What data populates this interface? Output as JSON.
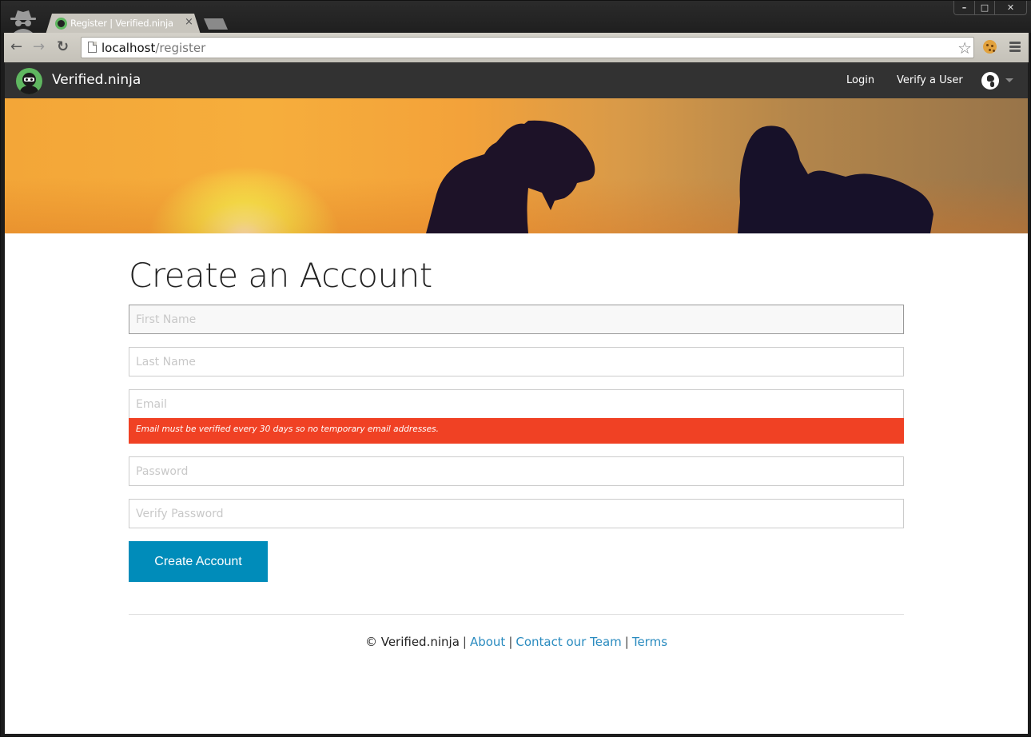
{
  "browser": {
    "tab_title": "Register | Verified.ninja",
    "tab_close": "×",
    "url_host": "localhost",
    "url_path": "/register",
    "window_controls": {
      "minimize": "–",
      "maximize": "□",
      "close": "✕"
    },
    "nav": {
      "back": "←",
      "forward": "→",
      "reload": "↻"
    },
    "star": "☆"
  },
  "site": {
    "brand": "Verified.ninja",
    "nav_links": [
      {
        "label": "Login"
      },
      {
        "label": "Verify a User"
      }
    ]
  },
  "form": {
    "title": "Create an Account",
    "fields": [
      {
        "name": "first_name",
        "placeholder": "First Name",
        "value": ""
      },
      {
        "name": "last_name",
        "placeholder": "Last Name",
        "value": ""
      },
      {
        "name": "email",
        "placeholder": "Email",
        "value": ""
      },
      {
        "name": "password",
        "placeholder": "Password",
        "value": ""
      },
      {
        "name": "verify_password",
        "placeholder": "Verify Password",
        "value": ""
      }
    ],
    "email_error": "Email must be verified every 30 days so no temporary email addresses.",
    "submit_label": "Create Account",
    "colors": {
      "error": "#f04124",
      "primary": "#008cba"
    }
  },
  "footer": {
    "copyright": "© Verified.ninja",
    "separator": "|",
    "links": [
      {
        "label": "About"
      },
      {
        "label": "Contact our Team"
      },
      {
        "label": "Terms"
      }
    ]
  }
}
